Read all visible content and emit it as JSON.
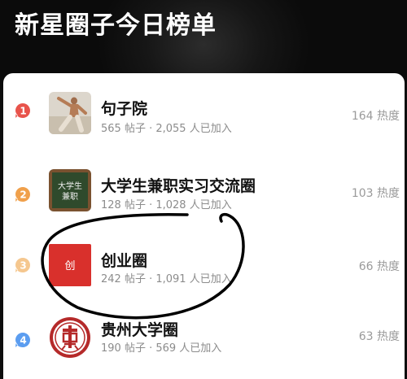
{
  "header": {
    "title": "新星圈子今日榜单"
  },
  "ranking": [
    {
      "rank": "1",
      "rank_color": "#e8534b",
      "icon": "person-photo-icon",
      "name": "句子院",
      "stats": "565 帖子 · 2,055 人已加入",
      "heat": "164 热度"
    },
    {
      "rank": "2",
      "rank_color": "#f0a04b",
      "icon": "chalkboard-icon",
      "icon_text_line1": "大学生",
      "icon_text_line2": "兼职",
      "name": "大学生兼职实习交流圈",
      "stats": "128 帖子 · 1,028 人已加入",
      "heat": "103 热度"
    },
    {
      "rank": "3",
      "rank_color": "#f5c78f",
      "icon": "chuang-logo-icon",
      "icon_text": "创",
      "name": "创业圈",
      "stats": "242 帖子 · 1,091 人已加入",
      "heat": "66 热度"
    },
    {
      "rank": "4",
      "rank_color": "#5b9df0",
      "icon": "university-seal-icon",
      "name": "贵州大学圈",
      "stats": "190 帖子 · 569 人已加入",
      "heat": "63 热度"
    }
  ],
  "colors": {
    "header_bg": "#0d0d0d",
    "card_bg": "#ffffff",
    "name_text": "#111111",
    "meta_text": "#8c8c8c",
    "chuang_red": "#d9302c",
    "seal_red": "#b52a2a",
    "chalkboard_green": "#2f4a2c",
    "annotation_ink": "#000000"
  }
}
